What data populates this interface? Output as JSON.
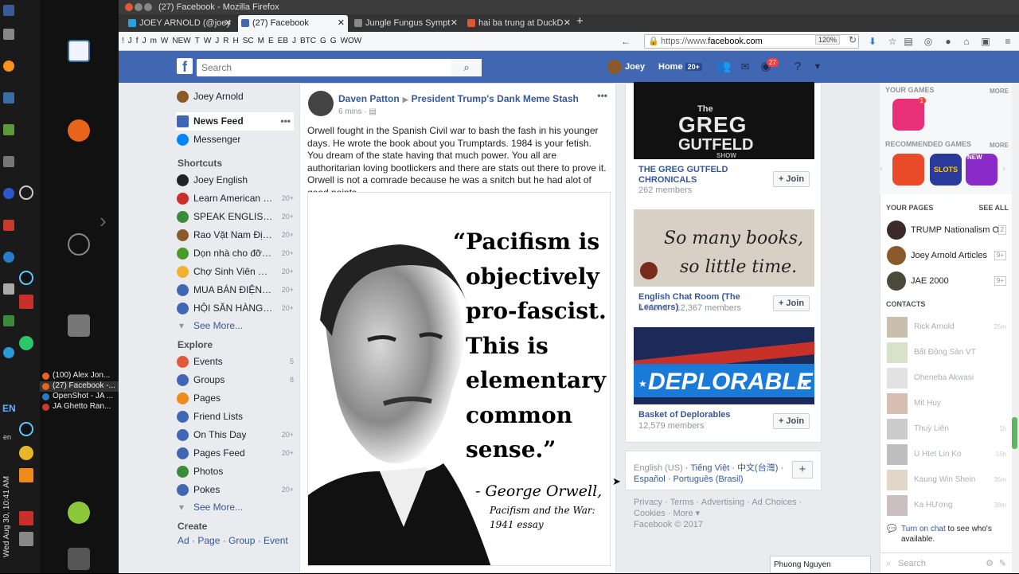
{
  "os": {
    "clock": "Wed Aug 30, 10:41 AM",
    "lang": "EN",
    "lang_small": "en",
    "taskbar": [
      "(100) Alex Jon...",
      "(27) Facebook -...",
      "OpenShot - JA ...",
      "JA Ghetto Ran..."
    ]
  },
  "browser": {
    "window_title": "(27) Facebook - Mozilla Firefox",
    "tabs": [
      {
        "label": "JOEY ARNOLD (@joey",
        "active": false
      },
      {
        "label": "(27) Facebook",
        "active": true
      },
      {
        "label": "Jungle Fungus Sympt",
        "active": false
      },
      {
        "label": "hai ba trung at DuckD",
        "active": false
      }
    ],
    "new_tab": "+",
    "bookmarks": [
      "!",
      "J",
      "f",
      "J",
      "m",
      "W",
      "NEW",
      "T",
      "W",
      "J",
      "R",
      "H",
      "SC",
      "M",
      "E",
      "EB",
      "J",
      "BTC",
      "G",
      "G",
      "WOW"
    ],
    "url_prefix": "https://www.",
    "url_domain": "facebook.com",
    "zoom": "120%"
  },
  "facebook": {
    "logo": "f",
    "search_placeholder": "Search",
    "user_name": "Joey",
    "home_label": "Home",
    "home_count": "20+",
    "notif_count": "27",
    "left_nav": {
      "profile": "Joey Arnold",
      "news_feed": "News Feed",
      "news_feed_more": "•••",
      "messenger": "Messenger",
      "shortcuts_title": "Shortcuts",
      "shortcuts": [
        {
          "label": "Joey English",
          "count": ""
        },
        {
          "label": "Learn American En...",
          "count": "20+"
        },
        {
          "label": "SPEAK ENGLISH F...",
          "count": "20+"
        },
        {
          "label": "Rao Vặt Nam Định",
          "count": "20+"
        },
        {
          "label": "Dọn nhà cho đỡ chật",
          "count": "20+"
        },
        {
          "label": "Chợ Sinh Viên Sư ...",
          "count": "20+"
        },
        {
          "label": "MUA BÁN ĐIỆN TH...",
          "count": "20+"
        },
        {
          "label": "HỘI SĂN HÀNG M...",
          "count": "20+"
        }
      ],
      "see_more": "See More...",
      "explore_title": "Explore",
      "explore": [
        {
          "label": "Events",
          "count": "5"
        },
        {
          "label": "Groups",
          "count": "8"
        },
        {
          "label": "Pages",
          "count": ""
        },
        {
          "label": "Friend Lists",
          "count": ""
        },
        {
          "label": "On This Day",
          "count": "20+"
        },
        {
          "label": "Pages Feed",
          "count": "20+"
        },
        {
          "label": "Photos",
          "count": ""
        },
        {
          "label": "Pokes",
          "count": "20+"
        }
      ],
      "see_more2": "See More...",
      "create_title": "Create",
      "create_links": "Ad · Page · Group · Event"
    },
    "post": {
      "author": "Daven Patton",
      "group": "President Trump's Dank Meme Stash",
      "time": "6 mins",
      "more": "•••",
      "text": "Orwell fought in the Spanish Civil war to bash the fash in his younger days. He wrote the book about you Trumptards. 1984 is your fetish. You dream of the state having that much power. You all are authoritarian loving bootlickers and there are stats out there to prove it. Orwell is not a comrade because he was a snitch but he had alot of good points.",
      "quote_lines": [
        "“Pacifism is",
        "objectively",
        "pro-fascist.",
        "This is",
        "elementary",
        "common",
        "sense.”"
      ],
      "signature": "- George Orwell,",
      "source_lines": [
        "Pacifism and the War:",
        "1941 essay"
      ]
    },
    "groups": [
      {
        "image_title": [
          "The",
          "GREG",
          "GUTFELD",
          "SHOW"
        ],
        "name": "THE GREG GUTFELD CHRONICALS",
        "members": "262 members",
        "join": "Join"
      },
      {
        "image_title": [
          "So many books,",
          "so little time."
        ],
        "name": "English Chat Room (The Learners)",
        "members": "1 friend · 12,367 members",
        "join": "Join"
      },
      {
        "image_title": [
          "DEPLORABLE"
        ],
        "name": "Basket of Deplorables",
        "members": "12,579 members",
        "join": "Join"
      }
    ],
    "languages": {
      "current": "English (US)",
      "others": [
        "Tiếng Việt",
        "中文(台灣)",
        "Español",
        "Português (Brasil)"
      ],
      "plus": "+"
    },
    "footer": {
      "links": "Privacy · Terms · Advertising · Ad Choices · Cookies · More ▾",
      "copyright": "Facebook © 2017"
    },
    "right": {
      "your_games": "YOUR GAMES",
      "recommended_games": "RECOMMENDED GAMES",
      "more": "MORE",
      "game_badge": "1",
      "rec_game_labels": [
        "SLOTS",
        "NEW"
      ],
      "your_pages": "YOUR PAGES",
      "see_all": "SEE ALL",
      "pages": [
        {
          "name": "TRUMP Nationalism O...",
          "count": "2"
        },
        {
          "name": "Joey Arnold Articles",
          "count": "9+"
        },
        {
          "name": "JAE 2000",
          "count": "9+"
        }
      ],
      "contacts_title": "CONTACTS",
      "contacts": [
        {
          "name": "Rick Arnold",
          "time": "25m"
        },
        {
          "name": "Bất Động Sản VT",
          "time": ""
        },
        {
          "name": "Oheneba Akwasi",
          "time": ""
        },
        {
          "name": "Mit Huy",
          "time": ""
        },
        {
          "name": "Thuỳ Liên",
          "time": "1h"
        },
        {
          "name": "U Htet Lin Ko",
          "time": "16h"
        },
        {
          "name": "Kaung Win Shein",
          "time": "36m"
        },
        {
          "name": "Ka HƯơng",
          "time": "38m"
        }
      ],
      "chat_link": "Turn on chat",
      "chat_note": " to see who's available.",
      "chat_search": "Search",
      "chat_tab": "Phuong Nguyen"
    }
  },
  "colors": {
    "fb_blue": "#4267b2",
    "link": "#365899",
    "bg": "#e9ebee",
    "scroll_thumb": "#5cb85c"
  }
}
